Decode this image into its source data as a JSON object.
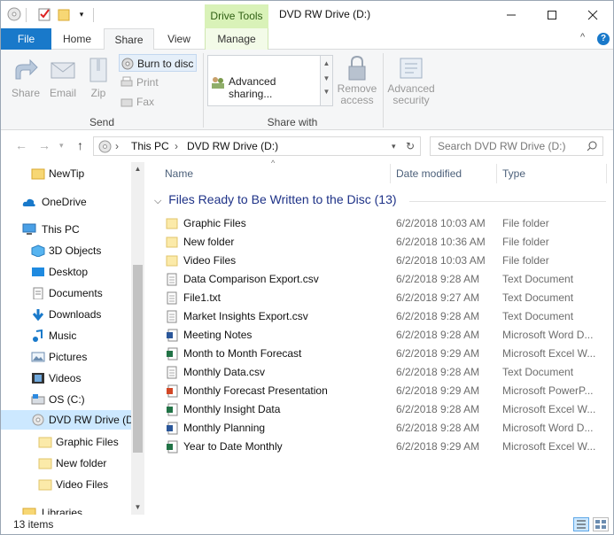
{
  "window": {
    "title": "DVD RW Drive (D:)",
    "context_tab_title": "Drive Tools"
  },
  "ribbon_tabs": [
    {
      "label": "File"
    },
    {
      "label": "Home"
    },
    {
      "label": "Share"
    },
    {
      "label": "View"
    },
    {
      "label": "Manage"
    }
  ],
  "ribbon": {
    "share": "Share",
    "email": "Email",
    "zip": "Zip",
    "burn": "Burn to disc",
    "print": "Print",
    "fax": "Fax",
    "send_group": "Send",
    "advanced_sharing": "Advanced sharing...",
    "remove_access_1": "Remove",
    "remove_access_2": "access",
    "advanced_security_1": "Advanced",
    "advanced_security_2": "security",
    "share_with_group": "Share with"
  },
  "address": {
    "segments": [
      "This PC",
      "DVD RW Drive (D:)"
    ],
    "search_placeholder": "Search DVD RW Drive (D:)"
  },
  "nav": [
    {
      "label": "NewTip",
      "icon": "folder-icon"
    },
    {
      "label": "OneDrive",
      "icon": "cloud-icon"
    },
    {
      "label": "This PC",
      "icon": "computer-icon"
    },
    {
      "label": "3D Objects",
      "icon": "cube-icon"
    },
    {
      "label": "Desktop",
      "icon": "desktop-icon"
    },
    {
      "label": "Documents",
      "icon": "documents-icon"
    },
    {
      "label": "Downloads",
      "icon": "download-arrow-icon"
    },
    {
      "label": "Music",
      "icon": "music-note-icon"
    },
    {
      "label": "Pictures",
      "icon": "pictures-icon"
    },
    {
      "label": "Videos",
      "icon": "film-icon"
    },
    {
      "label": "OS (C:)",
      "icon": "drive-icon"
    },
    {
      "label": "DVD RW Drive (D:",
      "icon": "disc-icon"
    },
    {
      "label": "Graphic Files",
      "icon": "folder-icon"
    },
    {
      "label": "New folder",
      "icon": "folder-icon"
    },
    {
      "label": "Video Files",
      "icon": "folder-icon"
    },
    {
      "label": "Libraries",
      "icon": "libraries-icon"
    }
  ],
  "columns": {
    "name": "Name",
    "date": "Date modified",
    "type": "Type"
  },
  "group_title": "Files Ready to Be Written to the Disc (13)",
  "files": [
    {
      "name": "Graphic Files",
      "date": "6/2/2018 10:03 AM",
      "type": "File folder",
      "icon": "folder-icon"
    },
    {
      "name": "New folder",
      "date": "6/2/2018 10:36 AM",
      "type": "File folder",
      "icon": "folder-icon"
    },
    {
      "name": "Video Files",
      "date": "6/2/2018 10:03 AM",
      "type": "File folder",
      "icon": "folder-icon"
    },
    {
      "name": "Data Comparison Export.csv",
      "date": "6/2/2018 9:28 AM",
      "type": "Text Document",
      "icon": "text-file-icon"
    },
    {
      "name": "File1.txt",
      "date": "6/2/2018 9:27 AM",
      "type": "Text Document",
      "icon": "text-file-icon"
    },
    {
      "name": "Market Insights Export.csv",
      "date": "6/2/2018 9:28 AM",
      "type": "Text Document",
      "icon": "text-file-icon"
    },
    {
      "name": "Meeting Notes",
      "date": "6/2/2018 9:28 AM",
      "type": "Microsoft Word D...",
      "icon": "word-file-icon"
    },
    {
      "name": "Month to Month Forecast",
      "date": "6/2/2018 9:29 AM",
      "type": "Microsoft Excel W...",
      "icon": "excel-file-icon"
    },
    {
      "name": "Monthly Data.csv",
      "date": "6/2/2018 9:28 AM",
      "type": "Text Document",
      "icon": "text-file-icon"
    },
    {
      "name": "Monthly Forecast Presentation",
      "date": "6/2/2018 9:29 AM",
      "type": "Microsoft PowerP...",
      "icon": "powerpoint-file-icon"
    },
    {
      "name": "Monthly Insight Data",
      "date": "6/2/2018 9:28 AM",
      "type": "Microsoft Excel W...",
      "icon": "excel-file-icon"
    },
    {
      "name": "Monthly Planning",
      "date": "6/2/2018 9:28 AM",
      "type": "Microsoft Word D...",
      "icon": "word-file-icon"
    },
    {
      "name": "Year to Date Monthly",
      "date": "6/2/2018 9:29 AM",
      "type": "Microsoft Excel W...",
      "icon": "excel-file-icon"
    }
  ],
  "status": {
    "item_count": "13 items"
  },
  "colors": {
    "accent": "#1979ca",
    "context_tab": "#d9f2b8",
    "selection": "#cce8ff",
    "group_header": "#1e3287"
  }
}
